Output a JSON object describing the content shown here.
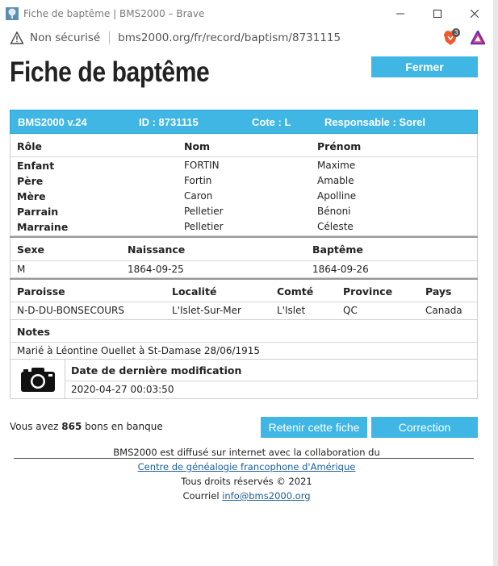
{
  "window": {
    "title": "Fiche de baptême | BMS2000 – Brave",
    "controls": [
      "minimize-icon",
      "maximize-icon",
      "close-icon"
    ]
  },
  "address_bar": {
    "security": "Non sécurisé",
    "url": "bms2000.org/fr/record/baptism/8731115",
    "brave_badge": "3"
  },
  "page": {
    "title": "Fiche de baptême",
    "close_label": "Fermer"
  },
  "banner": {
    "version": "BMS2000 v.24",
    "id": "ID : 8731115",
    "cote": "Cote : L",
    "responsable": "Responsable : Sorel"
  },
  "persons": {
    "headers": [
      "Rôle",
      "Nom",
      "Prénom"
    ],
    "rows": [
      {
        "role": "Enfant",
        "nom": "FORTIN",
        "prenom": "Maxime"
      },
      {
        "role": "Père",
        "nom": "Fortin",
        "prenom": "Amable"
      },
      {
        "role": "Mère",
        "nom": "Caron",
        "prenom": "Apolline"
      },
      {
        "role": "Parrain",
        "nom": "Pelletier",
        "prenom": "Bénoni"
      },
      {
        "role": "Marraine",
        "nom": "Pelletier",
        "prenom": "Céleste"
      }
    ]
  },
  "vitals": {
    "headers": [
      "Sexe",
      "Naissance",
      "Baptême"
    ],
    "values": [
      "M",
      "1864-09-25",
      "1864-09-26"
    ]
  },
  "place": {
    "headers": [
      "Paroisse",
      "Localité",
      "Comté",
      "Province",
      "Pays"
    ],
    "values": [
      "N-D-DU-BONSECOURS",
      "L'Islet-Sur-Mer",
      "L'Islet",
      "QC",
      "Canada"
    ]
  },
  "notes": {
    "header": "Notes",
    "text": "Marié à Léontine Ouellet à St-Damase 28/06/1915"
  },
  "modified": {
    "header": "Date de dernière modification",
    "value": "2020-04-27 00:03:50"
  },
  "bank": {
    "prefix": "Vous avez ",
    "count": "865",
    "suffix": " bons en banque"
  },
  "actions": {
    "retain_label": "Retenir cette fiche",
    "correct_label": "Correction"
  },
  "credits": {
    "line1": "BMS2000 est diffusé sur internet avec la collaboration du",
    "link1": "Centre de généalogie francophone d'Amérique",
    "line3": "Tous droits réservés © 2021",
    "line4_prefix": "Courriel ",
    "email": "info@bms2000.org"
  },
  "colors": {
    "accent": "#3fb6e4",
    "link": "#1a5fa0"
  }
}
